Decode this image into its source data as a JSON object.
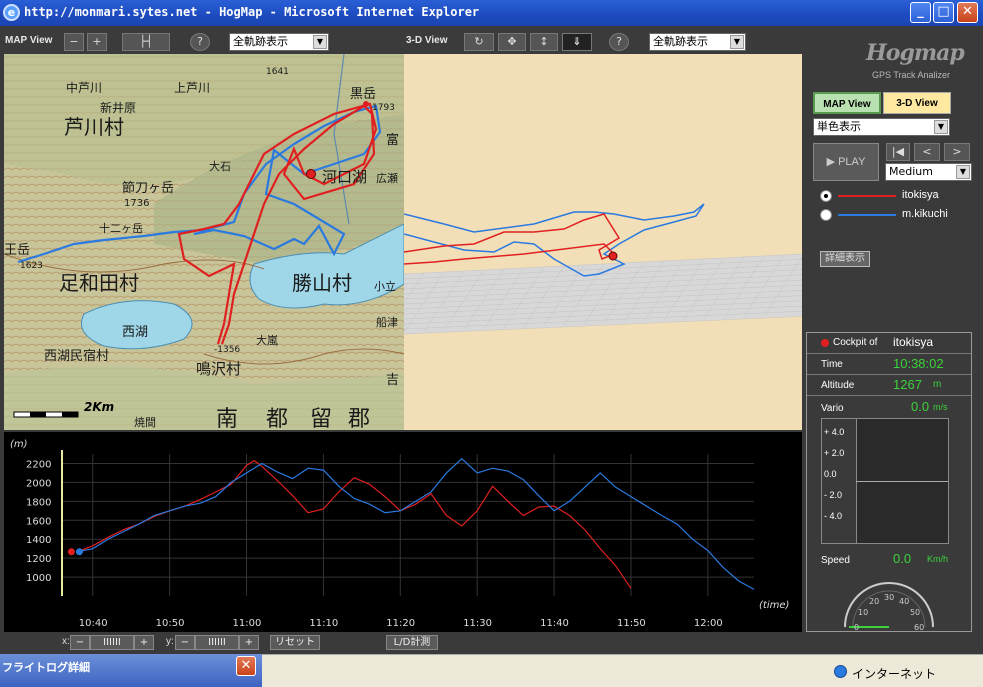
{
  "window": {
    "title": "http://monmari.sytes.net - HogMap - Microsoft Internet Explorer",
    "minimize": "_",
    "maximize": "□",
    "close": "✕"
  },
  "map_toolbar": {
    "label": "MAP View",
    "zoom_out": "−",
    "zoom_in": "+",
    "scale_btn": "├┤",
    "help_btn": "?",
    "track_select": "全軌跡表示"
  },
  "view3d_toolbar": {
    "label": "3-D View",
    "rotate_btn": "↻",
    "move_btn": "✥",
    "vertical_btn": "↕",
    "down_btn": "⇓",
    "help_btn": "?",
    "track_select": "全軌跡表示"
  },
  "map": {
    "labels": [
      {
        "text": "中芦川"
      },
      {
        "text": "上芦川"
      },
      {
        "text": "芦川村"
      },
      {
        "text": "新井原"
      },
      {
        "text": "節刀ヶ岳"
      },
      {
        "text": "1736"
      },
      {
        "text": "十二ヶ岳"
      },
      {
        "text": "足和田村"
      },
      {
        "text": "河口湖"
      },
      {
        "text": "勝山村"
      },
      {
        "text": "西湖"
      },
      {
        "text": "鳴沢村"
      },
      {
        "text": "西湖民宿村"
      },
      {
        "text": "大石"
      },
      {
        "text": "南"
      },
      {
        "text": "都"
      },
      {
        "text": "留"
      },
      {
        "text": "郡"
      },
      {
        "text": "黒岳"
      },
      {
        "text": "1793"
      },
      {
        "text": "1641"
      },
      {
        "text": "-1356"
      },
      {
        "text": "小立"
      },
      {
        "text": "大嵐"
      },
      {
        "text": "王岳"
      },
      {
        "text": "1623"
      },
      {
        "text": "焼間"
      },
      {
        "text": "船津"
      },
      {
        "text": "広瀬"
      },
      {
        "text": "富"
      },
      {
        "text": "吉"
      }
    ],
    "scale_label": "2Km"
  },
  "right_panel": {
    "logo": "Hogmap",
    "logo_sub": "GPS Track Analizer",
    "tab_map": "MAP View",
    "tab_3d": "3-D View",
    "color_select": "単色表示",
    "play": "PLAY",
    "btn_start": "|◀",
    "btn_prev": "<",
    "btn_next": ">",
    "speed_select": "Medium",
    "pilots": [
      {
        "name": "itokisya",
        "color": "#e02020",
        "selected": true
      },
      {
        "name": "m.kikuchi",
        "color": "#2a7ae0",
        "selected": false
      }
    ],
    "detail_btn": "詳細表示"
  },
  "cockpit": {
    "label": "Cockpit of",
    "pilot": "itokisya",
    "time_label": "Time",
    "time_value": "10:38:02",
    "altitude_label": "Altitude",
    "altitude_value": "1267",
    "altitude_unit": "m",
    "vario_label": "Vario",
    "vario_value": "0.0",
    "vario_unit": "m/s",
    "vario_ticks": [
      "+ 4.0",
      "+ 2.0",
      "0.0",
      "- 2.0",
      "- 4.0"
    ],
    "speed_label": "Speed",
    "speed_value": "0.0",
    "speed_unit": "Km/h",
    "gauge_ticks": [
      "0",
      "10",
      "20",
      "30",
      "40",
      "50",
      "60"
    ]
  },
  "bottom_bar": {
    "x_label": "x:",
    "y_label": "y:",
    "minus": "−",
    "plus": "+",
    "bars": "IIIIII",
    "reset": "リセット",
    "ld_calc": "L/D計測"
  },
  "status": {
    "flightlog_title": "フライトログ詳細",
    "flightlog_close": "✕",
    "internet": "インターネット"
  },
  "chart_data": {
    "type": "line",
    "ylabel": "(m)",
    "xlabel": "(time)",
    "ylim": [
      800,
      2300
    ],
    "y_ticks": [
      1000,
      1200,
      1400,
      1600,
      1800,
      2000,
      2200
    ],
    "x_ticks": [
      "10:40",
      "10:50",
      "11:00",
      "11:10",
      "11:20",
      "11:30",
      "11:40",
      "11:50",
      "12:00"
    ],
    "grid": true,
    "series": [
      {
        "name": "itokisya",
        "color": "#e02020",
        "x": [
          "10:38",
          "10:40",
          "10:42",
          "10:44",
          "10:46",
          "10:48",
          "10:50",
          "10:52",
          "10:54",
          "10:56",
          "10:58",
          "11:00",
          "11:01",
          "11:02",
          "11:04",
          "11:06",
          "11:08",
          "11:10",
          "11:12",
          "11:14",
          "11:16",
          "11:18",
          "11:20",
          "11:22",
          "11:24",
          "11:26",
          "11:28",
          "11:30",
          "11:32",
          "11:34",
          "11:36",
          "11:38",
          "11:40",
          "11:42",
          "11:44",
          "11:46",
          "11:48",
          "11:50"
        ],
        "y": [
          1267,
          1330,
          1420,
          1500,
          1560,
          1640,
          1700,
          1750,
          1820,
          1900,
          1980,
          2180,
          2230,
          2170,
          2020,
          1860,
          1680,
          1720,
          1900,
          2050,
          1980,
          1850,
          1700,
          1770,
          1880,
          1650,
          1540,
          1700,
          1960,
          1800,
          1650,
          1740,
          1750,
          1650,
          1500,
          1300,
          1120,
          880
        ]
      },
      {
        "name": "m.kikuchi",
        "color": "#2a7ae0",
        "x": [
          "10:38",
          "10:40",
          "10:42",
          "10:44",
          "10:46",
          "10:48",
          "10:50",
          "10:52",
          "10:54",
          "10:56",
          "10:58",
          "11:00",
          "11:02",
          "11:04",
          "11:06",
          "11:08",
          "11:10",
          "11:12",
          "11:14",
          "11:16",
          "11:18",
          "11:20",
          "11:22",
          "11:24",
          "11:26",
          "11:28",
          "11:30",
          "11:32",
          "11:34",
          "11:36",
          "11:38",
          "11:40",
          "11:42",
          "11:44",
          "11:46",
          "11:48",
          "11:50",
          "11:52",
          "11:54",
          "11:56",
          "11:58",
          "12:00",
          "12:02",
          "12:04",
          "12:06"
        ],
        "y": [
          1267,
          1300,
          1400,
          1480,
          1560,
          1650,
          1700,
          1750,
          1780,
          1850,
          2000,
          2100,
          2200,
          2110,
          2040,
          2150,
          2130,
          1960,
          1830,
          1770,
          1680,
          1700,
          1800,
          1900,
          2100,
          2250,
          2100,
          2150,
          2120,
          2030,
          1860,
          1700,
          1800,
          1950,
          2100,
          1950,
          1850,
          1750,
          1650,
          1560,
          1400,
          1280,
          1100,
          960,
          870
        ]
      }
    ]
  }
}
